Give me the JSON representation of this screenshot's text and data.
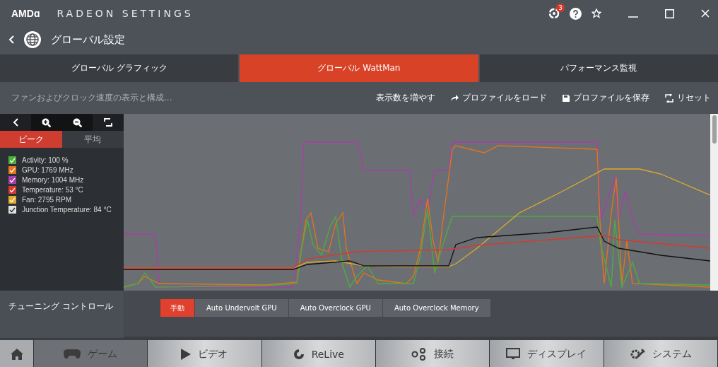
{
  "app_title": {
    "brand": "AMDɑ",
    "name": "RADEON SETTINGS"
  },
  "title_bar": {
    "notification_count": "3"
  },
  "header": {
    "title": "グローバル設定"
  },
  "tabs": [
    {
      "label": "グローバル グラフィック",
      "selected": false
    },
    {
      "label": "グローバル WattMan",
      "selected": true
    },
    {
      "label": "パフォーマンス監視",
      "selected": false
    }
  ],
  "toolbar": {
    "description": "ファンおよびクロック速度の表示と構成...",
    "actions": [
      {
        "kind": "text",
        "label": "表示数を増やす"
      },
      {
        "kind": "load",
        "label": "プロファイルをロード"
      },
      {
        "kind": "save",
        "label": "プロファイルを保存"
      },
      {
        "kind": "reset",
        "label": "リセット"
      }
    ]
  },
  "mode_tabs": [
    {
      "label": "ピーク",
      "selected": true
    },
    {
      "label": "平均",
      "selected": false
    }
  ],
  "legend": [
    {
      "label": "Activity: 100 %",
      "color": "#4caf3c",
      "checked": true
    },
    {
      "label": "GPU: 1769 MHz",
      "color": "#e8731a",
      "checked": true
    },
    {
      "label": "Memory: 1004 MHz",
      "color": "#a83ea8",
      "checked": true
    },
    {
      "label": "Temperature: 53 °C",
      "color": "#d9382c",
      "checked": true
    },
    {
      "label": "Fan: 2795 RPM",
      "color": "#e0aa2a",
      "checked": true
    },
    {
      "label": "Junction Temperature: 84 °C",
      "color": "#e0e0e0",
      "checked": true
    }
  ],
  "tuning": {
    "label": "チューニング コントロール",
    "options": [
      {
        "label": "手動",
        "selected": true
      },
      {
        "label": "Auto Undervolt GPU",
        "selected": false
      },
      {
        "label": "Auto Overclock GPU",
        "selected": false
      },
      {
        "label": "Auto Overclock Memory",
        "selected": false
      }
    ]
  },
  "bottom_nav": [
    {
      "kind": "home"
    },
    {
      "kind": "game",
      "label": "ゲーム",
      "selected": true
    },
    {
      "kind": "video",
      "label": "ビデオ",
      "selected": false
    },
    {
      "kind": "relive",
      "label": "ReLive",
      "selected": false
    },
    {
      "kind": "connect",
      "label": "接続",
      "selected": false
    },
    {
      "kind": "display",
      "label": "ディスプレイ",
      "selected": false
    },
    {
      "kind": "system",
      "label": "システム",
      "selected": false
    }
  ]
}
